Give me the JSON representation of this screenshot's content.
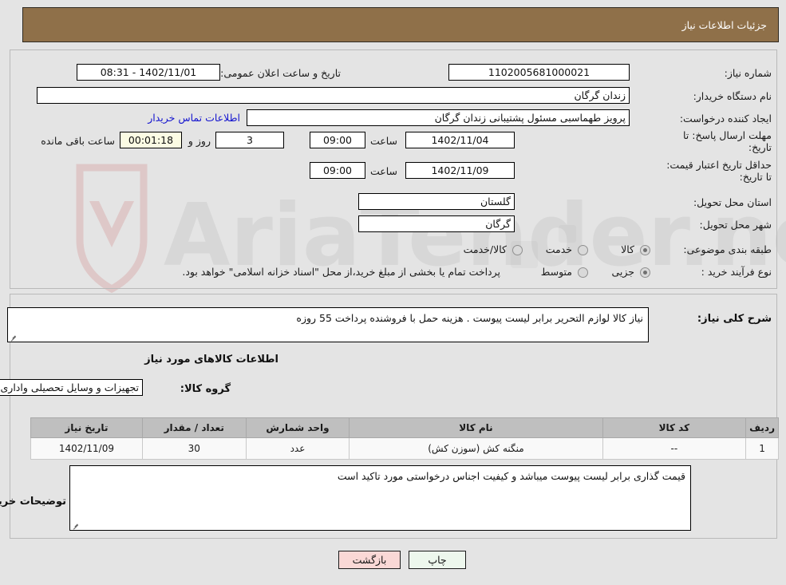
{
  "header": {
    "title": "جزئیات اطلاعات نیاز",
    "bar_color": "#8f7049"
  },
  "top_panel": {
    "need_number_label": "شماره نیاز:",
    "need_number_value": "1102005681000021",
    "public_announce_label": "تاریخ و ساعت اعلان عمومی:",
    "public_announce_value": "1402/11/01 - 08:31",
    "buyer_org_label": "نام دستگاه خریدار:",
    "buyer_org_value": "زندان گرگان",
    "request_creator_label": "ایجاد کننده درخواست:",
    "request_creator_value": "پرویز طهماسبی مسئول پشتیبانی زندان گرگان",
    "buyer_contact_link": "اطلاعات تماس خریدار",
    "reply_deadline_label": "مهلت ارسال پاسخ: تا تاریخ:",
    "reply_deadline_date": "1402/11/04",
    "hour_label": "ساعت",
    "reply_deadline_time": "09:00",
    "remaining_days": "3",
    "days_and_label": "روز و",
    "remaining_clock": "00:01:18",
    "remaining_suffix": "ساعت باقی مانده",
    "price_validity_label": "حداقل تاریخ اعتبار قیمت: تا تاریخ:",
    "price_validity_date": "1402/11/09",
    "price_validity_time": "09:00",
    "province_label": "استان محل تحویل:",
    "province_value": "گلستان",
    "city_label": "شهر محل تحویل:",
    "city_value": "گرگان",
    "category_label": "طبقه بندی موضوعی:",
    "category_options": [
      "کالا",
      "خدمت",
      "کالا/خدمت"
    ],
    "category_selected": "کالا",
    "process_type_label": "نوع فرآیند خرید :",
    "process_options": [
      "جزیی",
      "متوسط"
    ],
    "process_selected": "جزیی",
    "treasury_note": "پرداخت تمام یا بخشی از مبلغ خرید،از محل \"اسناد خزانه اسلامی\" خواهد بود."
  },
  "mid_panel": {
    "need_desc_label": "شرح کلی نیاز:",
    "need_desc_value": "نیاز کالا لوازم التحریر برابر لیست پیوست . هزینه حمل با فروشنده پرداخت 55 روزه",
    "goods_info_title": "اطلاعات کالاهای مورد نیاز",
    "goods_group_label": "گروه کالا:",
    "goods_group_value": "تجهیزات و وسایل تحصیلی واداری",
    "table": {
      "headers": [
        "ردیف",
        "کد کالا",
        "نام کالا",
        "واحد شمارش",
        "تعداد / مقدار",
        "تاریخ نیاز"
      ],
      "rows": [
        [
          "1",
          "--",
          "منگنه کش (سوزن کش)",
          "عدد",
          "30",
          "1402/11/09"
        ]
      ]
    },
    "buyer_notes_label": "توضیحات خریدار:",
    "buyer_notes_value": "قیمت گذاری برابر لیست پیوست میباشد و کیفیت اجناس درخواستی مورد تاکید است"
  },
  "footer": {
    "print_button": "چاپ",
    "back_button": "بازگشت"
  },
  "watermark": {
    "text": "AriaTender.net"
  }
}
